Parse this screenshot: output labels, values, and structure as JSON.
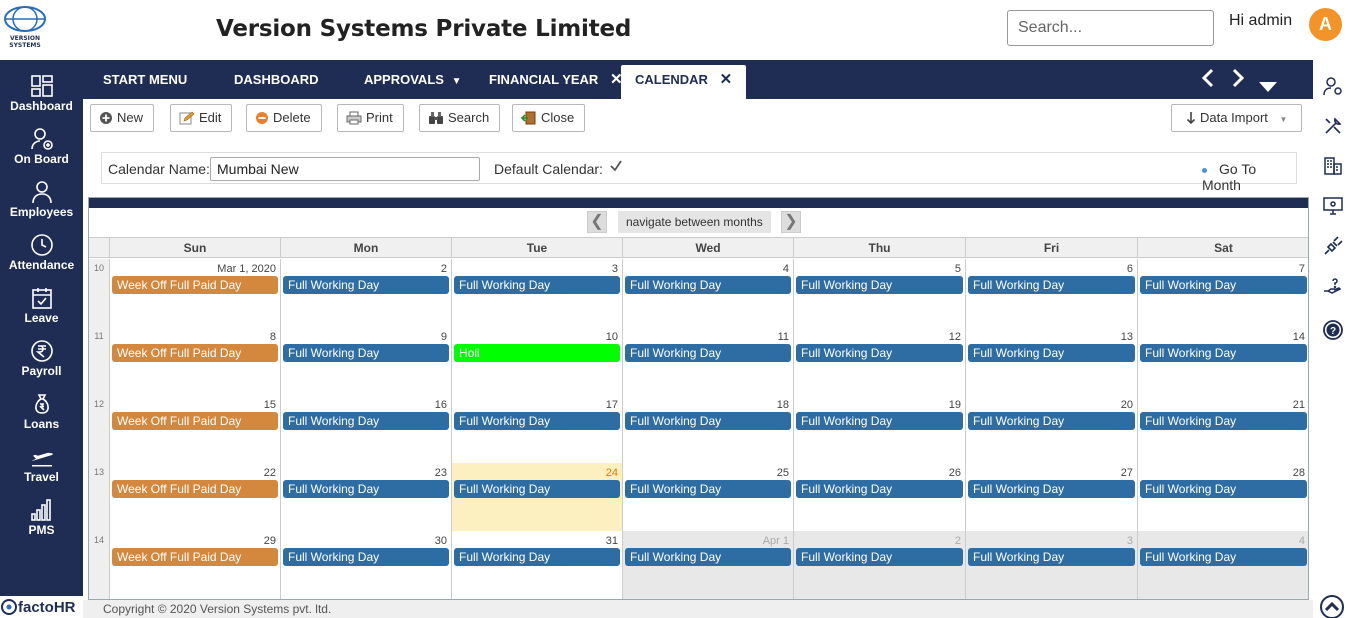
{
  "header": {
    "company": "Version Systems Private Limited",
    "search_placeholder": "Search...",
    "greeting": "Hi admin",
    "avatar_letter": "A",
    "logo_text": "VERSION SYSTEMS"
  },
  "sidebar": {
    "items": [
      {
        "label": "Dashboard",
        "icon": "dashboard-icon"
      },
      {
        "label": "On Board",
        "icon": "onboard-icon"
      },
      {
        "label": "Employees",
        "icon": "employees-icon"
      },
      {
        "label": "Attendance",
        "icon": "clock-icon"
      },
      {
        "label": "Leave",
        "icon": "calendar-check-icon"
      },
      {
        "label": "Payroll",
        "icon": "rupee-icon"
      },
      {
        "label": "Loans",
        "icon": "money-bag-icon"
      },
      {
        "label": "Travel",
        "icon": "plane-icon"
      },
      {
        "label": "PMS",
        "icon": "bar-chart-icon"
      }
    ],
    "brand": "factoHR"
  },
  "tabs": [
    {
      "label": "START MENU"
    },
    {
      "label": "DASHBOARD"
    },
    {
      "label": "APPROVALS"
    },
    {
      "label": "FINANCIAL YEAR"
    },
    {
      "label": "CALENDAR"
    }
  ],
  "toolbar": {
    "new": "New",
    "edit": "Edit",
    "delete": "Delete",
    "print": "Print",
    "search": "Search",
    "close": "Close",
    "data_import": "Data Import"
  },
  "filter": {
    "calendar_name_label": "Calendar Name:",
    "calendar_name_value": "Mumbai New",
    "default_label": "Default Calendar:",
    "default_checked": true,
    "goto_month": "Go To Month"
  },
  "calendar": {
    "nav_text": "navigate between months",
    "prev": "❮",
    "next": "❯",
    "days_of_week": [
      "Sun",
      "Mon",
      "Tue",
      "Wed",
      "Thu",
      "Fri",
      "Sat"
    ],
    "colors": {
      "working": "#2e6da4",
      "weekoff": "#d4883e",
      "holiday": "#00ff00",
      "today_bg": "#fcf0c0"
    },
    "weeks": [
      {
        "week": "10",
        "days": [
          {
            "date": "Mar 1, 2020",
            "event": "Week Off Full Paid Day",
            "type": "weekoff"
          },
          {
            "date": "2",
            "event": "Full Working Day",
            "type": "working"
          },
          {
            "date": "3",
            "event": "Full Working Day",
            "type": "working"
          },
          {
            "date": "4",
            "event": "Full Working Day",
            "type": "working"
          },
          {
            "date": "5",
            "event": "Full Working Day",
            "type": "working"
          },
          {
            "date": "6",
            "event": "Full Working Day",
            "type": "working"
          },
          {
            "date": "7",
            "event": "Full Working Day",
            "type": "working"
          }
        ]
      },
      {
        "week": "11",
        "days": [
          {
            "date": "8",
            "event": "Week Off Full Paid Day",
            "type": "weekoff"
          },
          {
            "date": "9",
            "event": "Full Working Day",
            "type": "working"
          },
          {
            "date": "10",
            "event": "Holi",
            "type": "holiday"
          },
          {
            "date": "11",
            "event": "Full Working Day",
            "type": "working"
          },
          {
            "date": "12",
            "event": "Full Working Day",
            "type": "working"
          },
          {
            "date": "13",
            "event": "Full Working Day",
            "type": "working"
          },
          {
            "date": "14",
            "event": "Full Working Day",
            "type": "working"
          }
        ]
      },
      {
        "week": "12",
        "days": [
          {
            "date": "15",
            "event": "Week Off Full Paid Day",
            "type": "weekoff"
          },
          {
            "date": "16",
            "event": "Full Working Day",
            "type": "working"
          },
          {
            "date": "17",
            "event": "Full Working Day",
            "type": "working"
          },
          {
            "date": "18",
            "event": "Full Working Day",
            "type": "working"
          },
          {
            "date": "19",
            "event": "Full Working Day",
            "type": "working"
          },
          {
            "date": "20",
            "event": "Full Working Day",
            "type": "working"
          },
          {
            "date": "21",
            "event": "Full Working Day",
            "type": "working"
          }
        ]
      },
      {
        "week": "13",
        "days": [
          {
            "date": "22",
            "event": "Week Off Full Paid Day",
            "type": "weekoff"
          },
          {
            "date": "23",
            "event": "Full Working Day",
            "type": "working"
          },
          {
            "date": "24",
            "event": "Full Working Day",
            "type": "working",
            "today": true
          },
          {
            "date": "25",
            "event": "Full Working Day",
            "type": "working"
          },
          {
            "date": "26",
            "event": "Full Working Day",
            "type": "working"
          },
          {
            "date": "27",
            "event": "Full Working Day",
            "type": "working"
          },
          {
            "date": "28",
            "event": "Full Working Day",
            "type": "working"
          }
        ]
      },
      {
        "week": "14",
        "days": [
          {
            "date": "29",
            "event": "Week Off Full Paid Day",
            "type": "weekoff"
          },
          {
            "date": "30",
            "event": "Full Working Day",
            "type": "working"
          },
          {
            "date": "31",
            "event": "Full Working Day",
            "type": "working"
          },
          {
            "date": "Apr 1",
            "event": "Full Working Day",
            "type": "working",
            "other": true
          },
          {
            "date": "2",
            "event": "Full Working Day",
            "type": "working",
            "other": true
          },
          {
            "date": "3",
            "event": "Full Working Day",
            "type": "working",
            "other": true
          },
          {
            "date": "4",
            "event": "Full Working Day",
            "type": "working",
            "other": true
          }
        ]
      }
    ]
  },
  "right_sidebar": [
    "user-gear-icon",
    "tools-icon",
    "building-icon",
    "monitor-icon",
    "plug-icon",
    "hand-question-icon",
    "help-icon",
    "scroll-up-icon"
  ],
  "footer": "Copyright © 2020 Version Systems pvt. ltd."
}
